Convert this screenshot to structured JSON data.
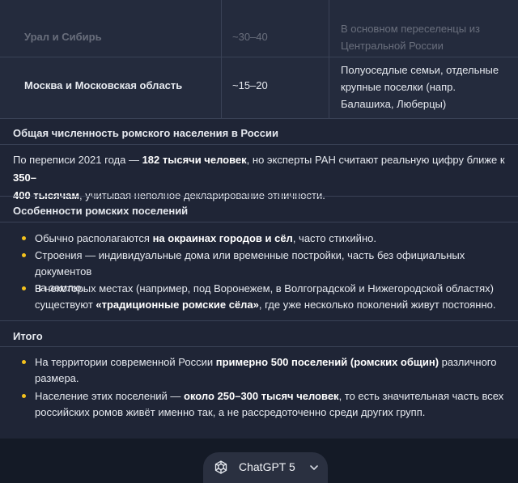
{
  "table": {
    "rows": [
      {
        "region": "Урал и Сибирь",
        "count": "~30–40",
        "note_lines": [
          "В основном переселенцы из",
          "Центральной России"
        ]
      },
      {
        "region": "Москва и Московская область",
        "count": "~15–20",
        "note_lines": [
          "Полуоседлые семьи, отдельные",
          "крупные поселки (напр.",
          "Балашиха, Люберцы)"
        ]
      }
    ]
  },
  "population": {
    "title": "Общая численность ромского населения в России",
    "line1_a": "По переписи 2021 года — ",
    "line1_b": "182 тысячи человек",
    "line1_c": ", но эксперты РАН считают реальную цифру ближе к ",
    "line1_d": "350–",
    "line2_a": "400 тысячам",
    "line2_b": ", учитывая неполное декларирование этничности."
  },
  "features": {
    "title": "Особенности ромских поселений",
    "items": [
      {
        "lines": [
          [
            "Обычно располагаются ",
            "на окраинах городов и сёл",
            ", часто стихийно."
          ]
        ]
      },
      {
        "lines": [
          [
            "Строения — индивидуальные дома или временные постройки, часть без официальных документов"
          ],
          [
            "на землю."
          ]
        ]
      },
      {
        "lines": [
          [
            "В некоторых местах (например, под Воронежем, в Волгоградской и Нижегородской областях)"
          ],
          [
            "существуют ",
            "«традиционные ромские сёла»",
            ", где уже несколько поколений живут постоянно."
          ]
        ]
      }
    ]
  },
  "summary": {
    "title": "Итого",
    "items": [
      {
        "lines": [
          [
            "На территории современной России ",
            "примерно 500 поселений (ромских общин)",
            " различного"
          ],
          [
            "размера."
          ]
        ]
      },
      {
        "lines": [
          [
            "Население этих поселений — ",
            "около 250–300 тысяч человек",
            ", то есть значительная часть всех"
          ],
          [
            "российских ромов живёт именно так, а не рассредоточенно среди других групп."
          ]
        ]
      }
    ]
  },
  "model_selector": {
    "label": "ChatGPT 5",
    "icon": "openai-logo-icon",
    "chevron": "chevron-down-icon"
  },
  "colors": {
    "bullet": "#f4c21d",
    "panel": "#1f2536",
    "background": "#141a26"
  }
}
